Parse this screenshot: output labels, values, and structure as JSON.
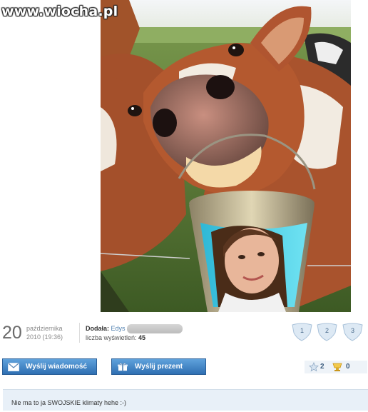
{
  "site": {
    "logo_text": "www.wiocha.pl"
  },
  "post": {
    "day": "20",
    "month": "października",
    "date_time": "2010 (19:36)",
    "added_by_label": "Dodała:",
    "added_by_user": "Edys",
    "views_label": "liczba wyświetleń:",
    "views": "45"
  },
  "votes": [
    "1",
    "2",
    "3"
  ],
  "buttons": {
    "message": "Wyślij wiadomość",
    "gift": "Wyślij prezent"
  },
  "scores": {
    "stars": "2",
    "gifts": "0"
  },
  "comment": {
    "text": "Nie ma to ja SWOJSKIE klimaty hehe :-)"
  },
  "colors": {
    "accent": "#3d7fc4",
    "comment_bg": "#e8f0f8",
    "vote_badge": "#d9e7f3"
  }
}
